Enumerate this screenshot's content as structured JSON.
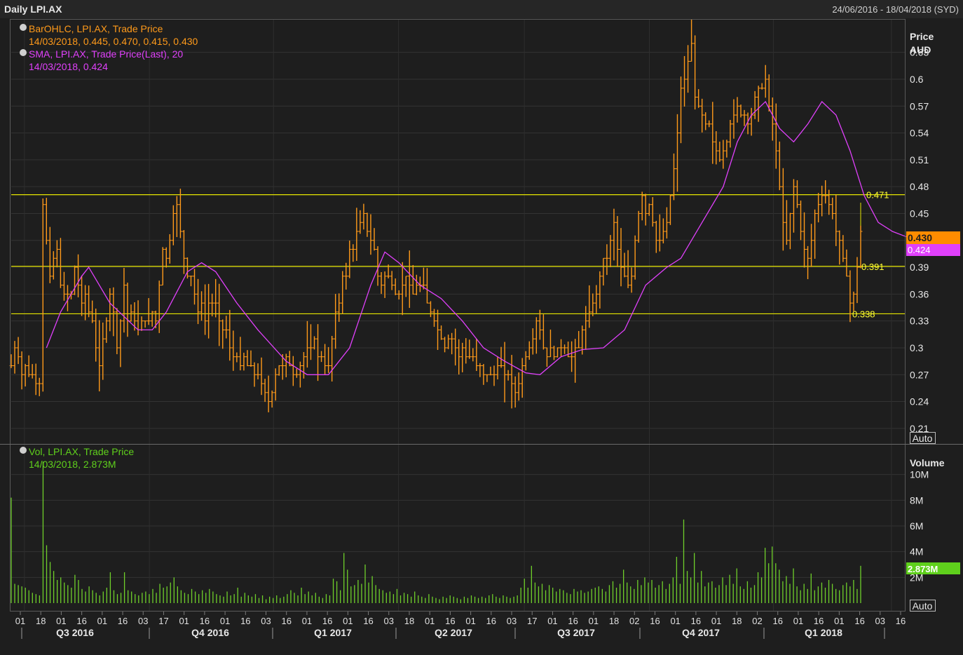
{
  "header": {
    "title": "Daily LPI.AX",
    "date_range": "24/06/2016 - 18/04/2018 (SYD)"
  },
  "price_panel": {
    "axis_title_1": "Price",
    "axis_title_2": "AUD",
    "auto_label": "Auto",
    "legend": [
      {
        "text": "BarOHLC, LPI.AX, Trade Price",
        "value": "14/03/2018, 0.445, 0.470, 0.415, 0.430",
        "color": "#ff9a1a"
      },
      {
        "text": "SMA, LPI.AX, Trade Price(Last),  20",
        "value": "14/03/2018, 0.424",
        "color": "#e040fb"
      }
    ],
    "last_price_label": "0.430",
    "sma_label": "0.424",
    "ticks": [
      "0.63",
      "0.6",
      "0.57",
      "0.54",
      "0.51",
      "0.48",
      "0.45",
      "0.42",
      "0.39",
      "0.36",
      "0.33",
      "0.3",
      "0.27",
      "0.24",
      "0.21"
    ],
    "hlines": [
      {
        "value": 0.471,
        "label": "0.471"
      },
      {
        "value": 0.391,
        "label": "0.391"
      },
      {
        "value": 0.338,
        "label": "0.338"
      }
    ]
  },
  "volume_panel": {
    "axis_title": "Volume",
    "auto_label": "Auto",
    "legend_text": "Vol, LPI.AX, Trade Price",
    "legend_value": "14/03/2018, 2.873M",
    "last_label": "2.873M",
    "ticks": [
      "10M",
      "8M",
      "6M",
      "4M",
      "2M"
    ]
  },
  "x_axis": {
    "day_labels": [
      "01",
      "18",
      "01",
      "16",
      "01",
      "16",
      "03",
      "17",
      "01",
      "16",
      "01",
      "16",
      "03",
      "16",
      "01",
      "16",
      "01",
      "16",
      "03",
      "18",
      "01",
      "16",
      "01",
      "16",
      "03",
      "17",
      "01",
      "16",
      "01",
      "18",
      "02",
      "16",
      "01",
      "16",
      "01",
      "18",
      "02",
      "16",
      "01",
      "16",
      "01",
      "16",
      "03",
      "16"
    ],
    "quarters": [
      "Q3 2016",
      "Q4 2016",
      "Q1 2017",
      "Q2 2017",
      "Q3 2017",
      "Q4 2017",
      "Q1 2018"
    ]
  },
  "chart_data": {
    "type": "line",
    "x_units": "trading-day index (0 = 24/06/2016)",
    "title": "Daily LPI.AX",
    "ylim": [
      0.195,
      0.665
    ],
    "volume_ylim_millions": [
      0,
      12
    ],
    "series": [
      {
        "name": "BarOHLC, LPI.AX, Trade Price",
        "color": "#ff9a1a",
        "close": [
          0.28,
          0.3,
          0.29,
          0.27,
          0.28,
          0.27,
          0.27,
          0.26,
          0.26,
          0.46,
          0.42,
          0.38,
          0.4,
          0.41,
          0.37,
          0.36,
          0.36,
          0.36,
          0.39,
          0.37,
          0.35,
          0.36,
          0.34,
          0.33,
          0.3,
          0.28,
          0.31,
          0.33,
          0.36,
          0.34,
          0.3,
          0.33,
          0.37,
          0.33,
          0.34,
          0.33,
          0.32,
          0.33,
          0.33,
          0.33,
          0.34,
          0.33,
          0.37,
          0.41,
          0.4,
          0.42,
          0.45,
          0.46,
          0.43,
          0.4,
          0.38,
          0.38,
          0.36,
          0.34,
          0.35,
          0.33,
          0.35,
          0.35,
          0.35,
          0.33,
          0.32,
          0.32,
          0.3,
          0.29,
          0.29,
          0.28,
          0.29,
          0.28,
          0.28,
          0.27,
          0.27,
          0.26,
          0.25,
          0.24,
          0.25,
          0.27,
          0.28,
          0.28,
          0.29,
          0.28,
          0.27,
          0.27,
          0.28,
          0.29,
          0.3,
          0.3,
          0.31,
          0.29,
          0.29,
          0.28,
          0.28,
          0.31,
          0.34,
          0.35,
          0.38,
          0.38,
          0.41,
          0.41,
          0.43,
          0.44,
          0.45,
          0.43,
          0.42,
          0.41,
          0.38,
          0.37,
          0.38,
          0.38,
          0.37,
          0.36,
          0.36,
          0.37,
          0.38,
          0.37,
          0.36,
          0.37,
          0.37,
          0.37,
          0.35,
          0.34,
          0.33,
          0.32,
          0.31,
          0.3,
          0.31,
          0.31,
          0.3,
          0.29,
          0.3,
          0.29,
          0.29,
          0.29,
          0.28,
          0.28,
          0.27,
          0.27,
          0.27,
          0.27,
          0.28,
          0.28,
          0.27,
          0.27,
          0.26,
          0.25,
          0.26,
          0.28,
          0.29,
          0.3,
          0.31,
          0.33,
          0.32,
          0.3,
          0.29,
          0.3,
          0.29,
          0.3,
          0.3,
          0.3,
          0.29,
          0.29,
          0.3,
          0.3,
          0.32,
          0.33,
          0.34,
          0.35,
          0.36,
          0.38,
          0.4,
          0.4,
          0.42,
          0.44,
          0.41,
          0.39,
          0.38,
          0.37,
          0.38,
          0.42,
          0.45,
          0.47,
          0.45,
          0.46,
          0.44,
          0.42,
          0.42,
          0.43,
          0.44,
          0.47,
          0.5,
          0.54,
          0.59,
          0.6,
          0.62,
          0.64,
          0.58,
          0.57,
          0.56,
          0.55,
          0.55,
          0.53,
          0.52,
          0.51,
          0.52,
          0.53,
          0.55,
          0.56,
          0.57,
          0.56,
          0.56,
          0.55,
          0.56,
          0.58,
          0.59,
          0.59,
          0.6,
          0.57,
          0.55,
          0.52,
          0.48,
          0.44,
          0.42,
          0.45,
          0.48,
          0.46,
          0.43,
          0.41,
          0.4,
          0.42,
          0.45,
          0.46,
          0.47,
          0.47,
          0.46,
          0.45,
          0.43,
          0.42,
          0.4,
          0.38,
          0.35,
          0.36,
          0.39,
          0.43
        ],
        "high_low_note": "bars drawn with +/- daily range around close"
      },
      {
        "name": "SMA, LPI.AX, Trade Price(Last),  20",
        "color": "#e040fb",
        "points": [
          [
            10,
            0.3
          ],
          [
            14,
            0.34
          ],
          [
            20,
            0.38
          ],
          [
            22,
            0.39
          ],
          [
            28,
            0.35
          ],
          [
            36,
            0.32
          ],
          [
            40,
            0.32
          ],
          [
            44,
            0.34
          ],
          [
            50,
            0.385
          ],
          [
            54,
            0.395
          ],
          [
            58,
            0.385
          ],
          [
            64,
            0.35
          ],
          [
            70,
            0.32
          ],
          [
            78,
            0.285
          ],
          [
            84,
            0.27
          ],
          [
            90,
            0.27
          ],
          [
            96,
            0.3
          ],
          [
            102,
            0.37
          ],
          [
            106,
            0.407
          ],
          [
            110,
            0.395
          ],
          [
            116,
            0.37
          ],
          [
            122,
            0.355
          ],
          [
            128,
            0.33
          ],
          [
            134,
            0.3
          ],
          [
            140,
            0.285
          ],
          [
            146,
            0.272
          ],
          [
            150,
            0.27
          ],
          [
            156,
            0.29
          ],
          [
            162,
            0.298
          ],
          [
            168,
            0.3
          ],
          [
            174,
            0.32
          ],
          [
            180,
            0.37
          ],
          [
            186,
            0.39
          ],
          [
            190,
            0.4
          ],
          [
            196,
            0.44
          ],
          [
            202,
            0.48
          ],
          [
            206,
            0.53
          ],
          [
            210,
            0.56
          ],
          [
            214,
            0.575
          ],
          [
            218,
            0.545
          ],
          [
            222,
            0.53
          ],
          [
            226,
            0.55
          ],
          [
            230,
            0.575
          ],
          [
            234,
            0.56
          ],
          [
            238,
            0.52
          ],
          [
            242,
            0.47
          ],
          [
            246,
            0.44
          ],
          [
            250,
            0.43
          ],
          [
            254,
            0.424
          ]
        ]
      }
    ],
    "volume_millions": [
      8.2,
      1.5,
      1.4,
      1.3,
      1.2,
      1,
      0.8,
      0.7,
      0.6,
      11,
      4.5,
      3.2,
      2.5,
      1.8,
      2,
      1.6,
      1.4,
      1.2,
      2.2,
      1.8,
      1.1,
      0.9,
      1.3,
      1,
      0.8,
      0.6,
      0.9,
      1.2,
      2.4,
      1,
      0.7,
      0.8,
      2.4,
      1,
      0.9,
      0.7,
      0.6,
      0.8,
      0.9,
      0.7,
      1.1,
      0.8,
      1.5,
      1.2,
      1.3,
      1.6,
      2,
      1.3,
      1,
      0.8,
      0.7,
      1.1,
      0.9,
      0.7,
      1,
      0.8,
      1.1,
      0.9,
      0.7,
      0.6,
      0.5,
      0.9,
      0.6,
      0.7,
      1.2,
      0.5,
      0.8,
      0.6,
      0.5,
      0.7,
      0.4,
      0.6,
      0.3,
      0.5,
      0.4,
      0.6,
      0.4,
      0.5,
      0.7,
      1,
      0.8,
      0.6,
      1.2,
      0.7,
      0.9,
      0.6,
      0.8,
      0.5,
      0.4,
      0.7,
      0.6,
      1.9,
      1.7,
      1,
      3.9,
      2.6,
      1.3,
      1.4,
      1.8,
      1.5,
      3,
      1.6,
      2.1,
      1.4,
      1.1,
      1,
      0.8,
      0.9,
      0.7,
      1.1,
      0.6,
      0.8,
      0.7,
      0.5,
      0.9,
      0.6,
      0.5,
      0.4,
      0.7,
      0.5,
      0.4,
      0.3,
      0.5,
      0.4,
      0.6,
      0.5,
      0.4,
      0.3,
      0.5,
      0.4,
      0.6,
      0.5,
      0.4,
      0.5,
      0.4,
      0.6,
      0.7,
      0.5,
      0.4,
      0.6,
      0.5,
      0.4,
      0.5,
      0.6,
      1.2,
      1.9,
      1.2,
      2.9,
      1.6,
      1.3,
      1.5,
      1,
      1.4,
      1.2,
      0.9,
      1.1,
      1,
      0.8,
      0.7,
      1.1,
      0.9,
      1,
      0.8,
      0.9,
      1.1,
      1.2,
      1.3,
      1.1,
      0.9,
      1.4,
      1.7,
      1.2,
      1.5,
      2.6,
      1.6,
      1.3,
      1.1,
      1.8,
      1.4,
      2,
      1.6,
      1.8,
      1.2,
      1.4,
      1.7,
      1.1,
      1.5,
      2,
      3.6,
      1.5,
      6.5,
      2.5,
      2,
      3.9,
      1.6,
      2.5,
      1.3,
      1.6,
      1.7,
      1.2,
      1.4,
      2,
      1.4,
      2.2,
      1.5,
      2.7,
      1.3,
      1.1,
      1.7,
      1.2,
      1.4,
      2.4,
      2,
      4.3,
      3.1,
      4.4,
      3.1,
      2.6,
      1.7,
      2.1,
      1.5,
      2.7,
      1.3,
      1,
      1.5,
      1.1,
      2.3,
      1,
      1.3,
      1.6,
      1.2,
      1.8,
      1.5,
      1.1,
      1,
      1.4,
      1.6,
      1.3,
      1.8,
      1.1,
      2.9
    ]
  }
}
